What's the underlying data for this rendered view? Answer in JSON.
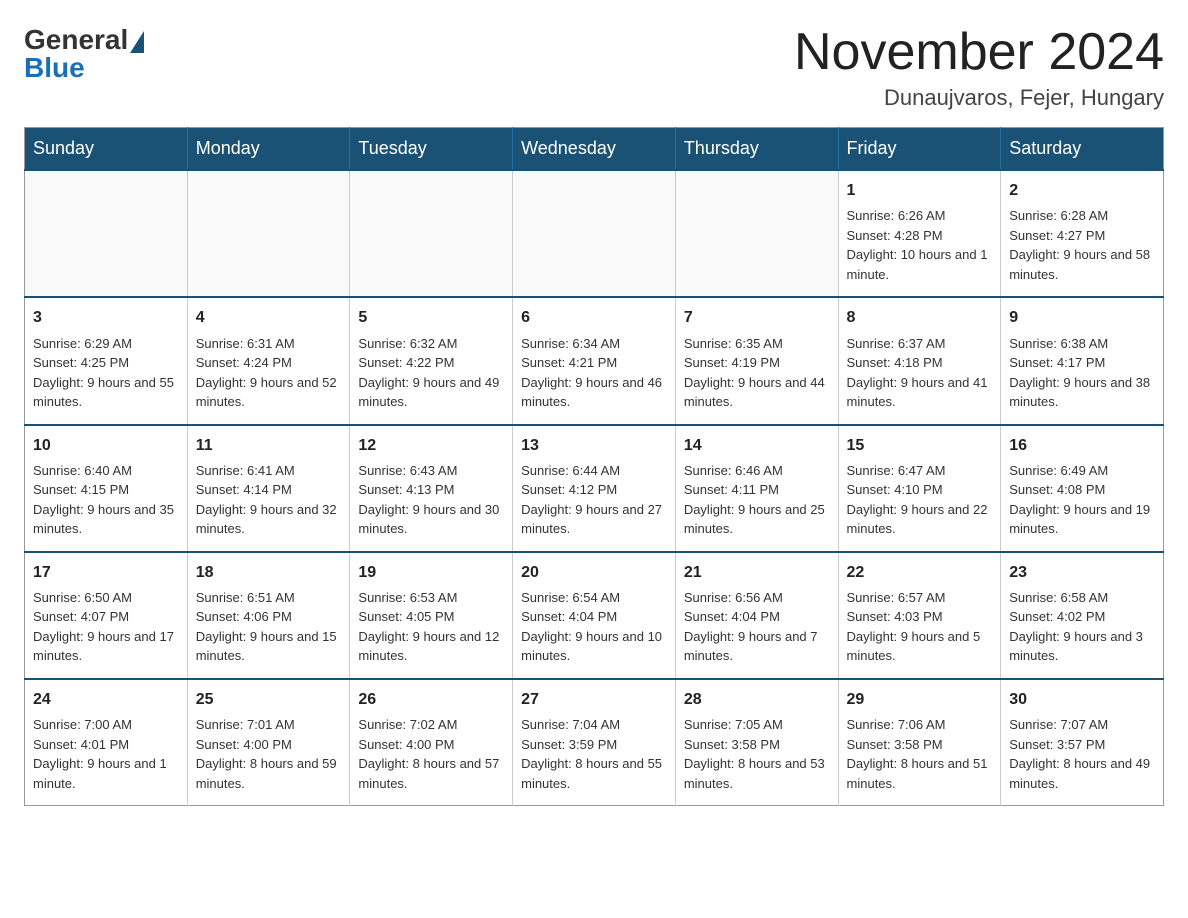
{
  "header": {
    "logo_general": "General",
    "logo_blue": "Blue",
    "month_year": "November 2024",
    "location": "Dunaujvaros, Fejer, Hungary"
  },
  "days_of_week": [
    "Sunday",
    "Monday",
    "Tuesday",
    "Wednesday",
    "Thursday",
    "Friday",
    "Saturday"
  ],
  "weeks": [
    [
      {
        "day": "",
        "info": ""
      },
      {
        "day": "",
        "info": ""
      },
      {
        "day": "",
        "info": ""
      },
      {
        "day": "",
        "info": ""
      },
      {
        "day": "",
        "info": ""
      },
      {
        "day": "1",
        "info": "Sunrise: 6:26 AM\nSunset: 4:28 PM\nDaylight: 10 hours and 1 minute."
      },
      {
        "day": "2",
        "info": "Sunrise: 6:28 AM\nSunset: 4:27 PM\nDaylight: 9 hours and 58 minutes."
      }
    ],
    [
      {
        "day": "3",
        "info": "Sunrise: 6:29 AM\nSunset: 4:25 PM\nDaylight: 9 hours and 55 minutes."
      },
      {
        "day": "4",
        "info": "Sunrise: 6:31 AM\nSunset: 4:24 PM\nDaylight: 9 hours and 52 minutes."
      },
      {
        "day": "5",
        "info": "Sunrise: 6:32 AM\nSunset: 4:22 PM\nDaylight: 9 hours and 49 minutes."
      },
      {
        "day": "6",
        "info": "Sunrise: 6:34 AM\nSunset: 4:21 PM\nDaylight: 9 hours and 46 minutes."
      },
      {
        "day": "7",
        "info": "Sunrise: 6:35 AM\nSunset: 4:19 PM\nDaylight: 9 hours and 44 minutes."
      },
      {
        "day": "8",
        "info": "Sunrise: 6:37 AM\nSunset: 4:18 PM\nDaylight: 9 hours and 41 minutes."
      },
      {
        "day": "9",
        "info": "Sunrise: 6:38 AM\nSunset: 4:17 PM\nDaylight: 9 hours and 38 minutes."
      }
    ],
    [
      {
        "day": "10",
        "info": "Sunrise: 6:40 AM\nSunset: 4:15 PM\nDaylight: 9 hours and 35 minutes."
      },
      {
        "day": "11",
        "info": "Sunrise: 6:41 AM\nSunset: 4:14 PM\nDaylight: 9 hours and 32 minutes."
      },
      {
        "day": "12",
        "info": "Sunrise: 6:43 AM\nSunset: 4:13 PM\nDaylight: 9 hours and 30 minutes."
      },
      {
        "day": "13",
        "info": "Sunrise: 6:44 AM\nSunset: 4:12 PM\nDaylight: 9 hours and 27 minutes."
      },
      {
        "day": "14",
        "info": "Sunrise: 6:46 AM\nSunset: 4:11 PM\nDaylight: 9 hours and 25 minutes."
      },
      {
        "day": "15",
        "info": "Sunrise: 6:47 AM\nSunset: 4:10 PM\nDaylight: 9 hours and 22 minutes."
      },
      {
        "day": "16",
        "info": "Sunrise: 6:49 AM\nSunset: 4:08 PM\nDaylight: 9 hours and 19 minutes."
      }
    ],
    [
      {
        "day": "17",
        "info": "Sunrise: 6:50 AM\nSunset: 4:07 PM\nDaylight: 9 hours and 17 minutes."
      },
      {
        "day": "18",
        "info": "Sunrise: 6:51 AM\nSunset: 4:06 PM\nDaylight: 9 hours and 15 minutes."
      },
      {
        "day": "19",
        "info": "Sunrise: 6:53 AM\nSunset: 4:05 PM\nDaylight: 9 hours and 12 minutes."
      },
      {
        "day": "20",
        "info": "Sunrise: 6:54 AM\nSunset: 4:04 PM\nDaylight: 9 hours and 10 minutes."
      },
      {
        "day": "21",
        "info": "Sunrise: 6:56 AM\nSunset: 4:04 PM\nDaylight: 9 hours and 7 minutes."
      },
      {
        "day": "22",
        "info": "Sunrise: 6:57 AM\nSunset: 4:03 PM\nDaylight: 9 hours and 5 minutes."
      },
      {
        "day": "23",
        "info": "Sunrise: 6:58 AM\nSunset: 4:02 PM\nDaylight: 9 hours and 3 minutes."
      }
    ],
    [
      {
        "day": "24",
        "info": "Sunrise: 7:00 AM\nSunset: 4:01 PM\nDaylight: 9 hours and 1 minute."
      },
      {
        "day": "25",
        "info": "Sunrise: 7:01 AM\nSunset: 4:00 PM\nDaylight: 8 hours and 59 minutes."
      },
      {
        "day": "26",
        "info": "Sunrise: 7:02 AM\nSunset: 4:00 PM\nDaylight: 8 hours and 57 minutes."
      },
      {
        "day": "27",
        "info": "Sunrise: 7:04 AM\nSunset: 3:59 PM\nDaylight: 8 hours and 55 minutes."
      },
      {
        "day": "28",
        "info": "Sunrise: 7:05 AM\nSunset: 3:58 PM\nDaylight: 8 hours and 53 minutes."
      },
      {
        "day": "29",
        "info": "Sunrise: 7:06 AM\nSunset: 3:58 PM\nDaylight: 8 hours and 51 minutes."
      },
      {
        "day": "30",
        "info": "Sunrise: 7:07 AM\nSunset: 3:57 PM\nDaylight: 8 hours and 49 minutes."
      }
    ]
  ]
}
